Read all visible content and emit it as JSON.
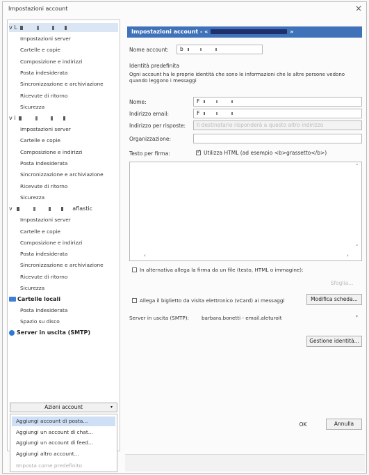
{
  "window": {
    "title": "Impostazioni account",
    "close": "×"
  },
  "tree": {
    "accounts": [
      {
        "prefix": "v L"
      },
      {
        "prefix": "v l"
      },
      {
        "prefix": "v ",
        "suffix": "aflastic"
      }
    ],
    "sub_items": [
      "Impostazioni server",
      "Cartelle e copie",
      "Composizione e indirizzi",
      "Posta indesiderata",
      "Sincronizzazione e archiviazione",
      "Ricevute di ritorno",
      "Sicurezza"
    ],
    "local_folders": "Cartelle locali",
    "local_sub": [
      "Posta indesiderata",
      "Spazio su disco"
    ],
    "smtp": "Server in uscita (SMTP)"
  },
  "account_actions": {
    "label": "Azioni account",
    "chevron": "▾",
    "menu": [
      "Aggiungi account di posta...",
      "Aggiungi un account di chat...",
      "Aggiungi un account di feed...",
      "Aggiungi altro account...",
      "Imposta come predefinito"
    ]
  },
  "panel": {
    "header": "Impostazioni account - «",
    "header_end": "»",
    "account_name_label": "Nome account:",
    "account_name_value": "b",
    "default_identity": "Identità predefinita",
    "identity_desc": "Ogni account ha le proprie identità che sono le informazioni che le altre persone vedono quando leggono i messaggi",
    "name_label": "Nome:",
    "name_value": "F",
    "email_label": "Indirizzo email:",
    "email_value": "F",
    "reply_label": "Indirizzo per risposte:",
    "reply_placeholder": "Il destinatario risponderà a questo altro indirizzo",
    "org_label": "Organizzazione:",
    "org_value": "",
    "signature_label": "Testo per firma:",
    "use_html": "Utilizza HTML (ad esempio <b>grassetto</b>)",
    "attach_sig": "In alternativa allega la firma da un file (testo, HTML o immagine):",
    "browse": "Sfoglia...",
    "vcard": "Allega il biglietto da visita elettronico (vCard) ai messaggi",
    "edit_card": "Modifica scheda...",
    "smtp_label": "Server in uscita (SMTP):",
    "smtp_value": "barbara.bonetti - email.aleturoit",
    "manage_identities": "Gestione identità...",
    "ok": "OK",
    "cancel": "Annulla"
  }
}
